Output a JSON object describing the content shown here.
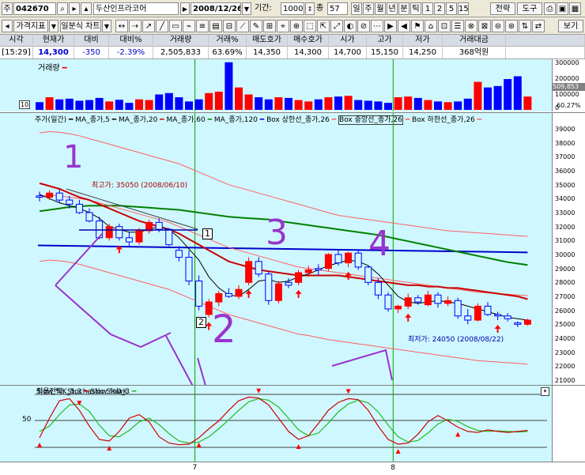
{
  "toolbar1": {
    "market_label": "주",
    "code": "042670",
    "name": "두산인프라코어",
    "date": "2008/12/26",
    "period_label": "기간:",
    "period_value": "1000",
    "count_label": "종",
    "count_value": "57",
    "interval_tabs": [
      "일",
      "주",
      "월",
      "년",
      "분",
      "틱",
      "1",
      "2",
      "5",
      "15"
    ],
    "strategy_button": "전략",
    "tools_button": "도구"
  },
  "toolbar2": {
    "price_indicator_label": "가격지표",
    "chart_type_label": "일분식 차트",
    "view_button": "보기"
  },
  "quote": {
    "headers": [
      "시각",
      "현재가",
      "대비",
      "대비%",
      "거래량",
      "거래%",
      "매도호가",
      "매수호가",
      "시가",
      "고가",
      "저가",
      "거래대금"
    ],
    "values": [
      "[15:29]",
      "14,300",
      "-350",
      "-2.39%",
      "2,505,833",
      "63.69%",
      "14,350",
      "14,300",
      "14,700",
      "15,150",
      "14,250",
      "368억원"
    ]
  },
  "volume_panel": {
    "title": "거래량",
    "scale_labels": [
      "300000",
      "200000",
      "100000",
      "0"
    ],
    "side_labels": [
      "509,853",
      "60.27%"
    ],
    "left_mark": "10"
  },
  "price_panel": {
    "legend": [
      "주가(일간)",
      "MA_종가,5",
      "MA_종가,20",
      "MA_종가,60",
      "MA_종가,120",
      "Box 상한선_종가,26",
      "Box 중앙선_종가,26",
      "Box 하한선_종가,26"
    ],
    "high_annotation": "최고가: 35050 (2008/06/10)",
    "low_annotation": "최저가: 24050 (2008/08/22)",
    "hand_marks": [
      "1",
      "2",
      "3",
      "4",
      "2"
    ],
    "box_marks": [
      "1",
      "2"
    ],
    "scale_labels": [
      "39000",
      "38000",
      "37000",
      "36000",
      "35000",
      "34000",
      "33000",
      "32000",
      "31000",
      "30000",
      "29000",
      "28000",
      "27000",
      "26000",
      "25000",
      "24000",
      "23000",
      "22000",
      "21000"
    ]
  },
  "stoch_panel": {
    "title": "적용전략: Stochastic SlowK",
    "legend": [
      "Slow %K_5,3",
      "Slow %D_3"
    ],
    "scale_labels": [
      "50"
    ]
  },
  "x_axis": {
    "labels": [
      "7",
      "8"
    ]
  },
  "colors": {
    "panel_bg": "#cff7ff",
    "up": "#ff0000",
    "down": "#0000ff",
    "ma5": "#000000",
    "ma20": "#cc0000",
    "ma60": "#008000",
    "ma120": "#0000cc",
    "box": "#ff6060",
    "hand": "#9933cc",
    "divider": "#00aa00"
  },
  "chart_data": {
    "type": "line",
    "title": "",
    "ylim": [
      21000,
      39500
    ],
    "ma120_y": 30650,
    "high": 35050,
    "low": 24050,
    "candles": [
      [
        34200,
        34500,
        33800,
        34100
      ],
      [
        34100,
        34600,
        33900,
        34400
      ],
      [
        34400,
        34700,
        33700,
        33900
      ],
      [
        33900,
        34200,
        33300,
        33600
      ],
      [
        33600,
        33900,
        32900,
        33000
      ],
      [
        33000,
        33300,
        32300,
        32400
      ],
      [
        32400,
        32700,
        31100,
        31200
      ],
      [
        31200,
        32200,
        31000,
        32000
      ],
      [
        32000,
        32200,
        31000,
        31200
      ],
      [
        31200,
        31600,
        30500,
        30900
      ],
      [
        30900,
        31900,
        30700,
        31700
      ],
      [
        31700,
        32500,
        31500,
        32300
      ],
      [
        32300,
        32600,
        31600,
        31800
      ],
      [
        31800,
        31900,
        30600,
        30700
      ],
      [
        30300,
        30600,
        29500,
        29800
      ],
      [
        29800,
        30300,
        27800,
        28100
      ],
      [
        28100,
        28500,
        26000,
        26300
      ],
      [
        25700,
        26800,
        25500,
        26600
      ],
      [
        26600,
        27400,
        26300,
        27200
      ],
      [
        27200,
        27600,
        26900,
        27000
      ],
      [
        27000,
        27800,
        26800,
        27500
      ],
      [
        28000,
        29800,
        27800,
        29500
      ],
      [
        29500,
        29800,
        28400,
        28600
      ],
      [
        28600,
        28800,
        26400,
        26700
      ],
      [
        26700,
        28100,
        26500,
        27900
      ],
      [
        28000,
        28300,
        27600,
        27800
      ],
      [
        28000,
        28900,
        27800,
        28700
      ],
      [
        28700,
        29200,
        28400,
        28900
      ],
      [
        29000,
        29300,
        28500,
        28900
      ],
      [
        29000,
        30100,
        28800,
        30000
      ],
      [
        30000,
        30300,
        29200,
        29400
      ],
      [
        29400,
        30200,
        29100,
        30100
      ],
      [
        30100,
        30300,
        28900,
        29100
      ],
      [
        29100,
        29200,
        27800,
        28000
      ],
      [
        28000,
        28300,
        26800,
        27100
      ],
      [
        27100,
        27300,
        25900,
        26100
      ],
      [
        26100,
        26400,
        25800,
        26300
      ],
      [
        26300,
        27200,
        26100,
        26900
      ],
      [
        26900,
        27100,
        26400,
        26600
      ],
      [
        26400,
        27400,
        26300,
        27100
      ],
      [
        27100,
        27300,
        26200,
        26500
      ],
      [
        26500,
        27000,
        26300,
        26700
      ],
      [
        26700,
        26900,
        25400,
        25600
      ],
      [
        25600,
        26100,
        25000,
        25300
      ],
      [
        25300,
        26500,
        25200,
        26300
      ],
      [
        26300,
        26600,
        25600,
        25700
      ],
      [
        25700,
        25900,
        25300,
        25600
      ],
      [
        25600,
        25800,
        25200,
        25400
      ],
      [
        25100,
        25200,
        24800,
        25000
      ],
      [
        25000,
        25400,
        24900,
        25300
      ]
    ],
    "volume": [
      55000,
      90000,
      75000,
      80000,
      65000,
      70000,
      85000,
      60000,
      72000,
      50000,
      75000,
      70000,
      110000,
      120000,
      90000,
      60000,
      75000,
      120000,
      130000,
      340000,
      160000,
      110000,
      90000,
      75000,
      90000,
      85000,
      70000,
      60000,
      75000,
      90000,
      95000,
      100000,
      70000,
      65000,
      60000,
      50000,
      90000,
      95000,
      85000,
      70000,
      60000,
      55000,
      60000,
      80000,
      200000,
      160000,
      170000,
      220000,
      240000,
      95000,
      100000,
      90000
    ],
    "ma5": [
      34300,
      34000,
      33700,
      33500,
      33300,
      33000,
      32600,
      32000,
      31800,
      31600,
      31600,
      31800,
      32000,
      31800,
      31200,
      30400,
      29600,
      28400,
      27600,
      27100,
      27000,
      27500,
      28100,
      28200,
      28000,
      28100,
      28400,
      28600,
      28900,
      29200,
      29400,
      29600,
      29500,
      29200,
      28600,
      27800,
      27000,
      26600,
      26500,
      26600,
      26700,
      26600,
      26500,
      26300,
      26100,
      25900,
      25700,
      25500,
      25400,
      25300
    ],
    "ma20": [
      35100,
      34900,
      34700,
      34400,
      34100,
      33900,
      33600,
      33300,
      33000,
      32700,
      32400,
      32200,
      32000,
      31800,
      31500,
      31100,
      30700,
      30300,
      29900,
      29500,
      29300,
      29100,
      28900,
      28800,
      28700,
      28600,
      28500,
      28500,
      28500,
      28500,
      28500,
      28400,
      28300,
      28200,
      28100,
      28000,
      27900,
      27800,
      27800,
      27700,
      27700,
      27600,
      27600,
      27500,
      27400,
      27300,
      27200,
      27100,
      27000,
      26800
    ],
    "ma60": [
      33100,
      33200,
      33300,
      33400,
      33450,
      33500,
      33500,
      33500,
      33500,
      33450,
      33400,
      33350,
      33300,
      33250,
      33200,
      33100,
      33000,
      32900,
      32800,
      32700,
      32650,
      32600,
      32550,
      32500,
      32400,
      32300,
      32200,
      32100,
      32000,
      31900,
      31800,
      31700,
      31600,
      31500,
      31400,
      31250,
      31100,
      30950,
      30800,
      30650,
      30500,
      30350,
      30200,
      30050,
      29900,
      29750,
      29600,
      29450,
      29350,
      29250
    ],
    "box_upper": [
      38700,
      38800,
      38750,
      38650,
      38500,
      38300,
      38100,
      37900,
      37700,
      37500,
      37300,
      37100,
      36900,
      36700,
      36500,
      36200,
      35900,
      35600,
      35300,
      35000,
      34800,
      34600,
      34400,
      34200,
      34000,
      33800,
      33600,
      33400,
      33200,
      33000,
      32800,
      32700,
      32600,
      32500,
      32400,
      32300,
      32200,
      32100,
      32000,
      31900,
      31800,
      31700,
      31650,
      31600,
      31550,
      31500,
      31450,
      31400,
      31350,
      31300
    ],
    "box_middle": [
      34200,
      34250,
      34200,
      34100,
      34000,
      33900,
      33700,
      33500,
      33300,
      33100,
      32900,
      32700,
      32500,
      32300,
      32000,
      31700,
      31400,
      31100,
      30800,
      30500,
      30300,
      30100,
      29900,
      29700,
      29500,
      29300,
      29100,
      29000,
      28900,
      28800,
      28700,
      28600,
      28500,
      28400,
      28300,
      28200,
      28100,
      28000,
      27900,
      27800,
      27700,
      27600,
      27500,
      27400,
      27300,
      27250,
      27200,
      27150,
      27100,
      27050
    ],
    "box_lower": [
      29500,
      29600,
      29550,
      29450,
      29300,
      29100,
      28900,
      28700,
      28500,
      28300,
      28100,
      27900,
      27700,
      27500,
      27200,
      26900,
      26600,
      26300,
      26000,
      25700,
      25500,
      25300,
      25100,
      24900,
      24700,
      24500,
      24300,
      24200,
      24050,
      23900,
      23800,
      23700,
      23600,
      23500,
      23400,
      23300,
      23200,
      23100,
      23000,
      22900,
      22800,
      22700,
      22600,
      22500,
      22400,
      22350,
      22300,
      22250,
      22200,
      22150
    ],
    "slow_k": [
      18,
      55,
      88,
      92,
      70,
      40,
      15,
      12,
      30,
      55,
      62,
      48,
      20,
      8,
      5,
      6,
      18,
      35,
      50,
      70,
      88,
      95,
      93,
      80,
      55,
      30,
      15,
      22,
      45,
      70,
      85,
      92,
      90,
      70,
      40,
      15,
      6,
      8,
      25,
      48,
      60,
      50,
      38,
      30,
      28,
      33,
      30,
      28,
      30,
      32
    ],
    "slow_d": [
      30,
      40,
      62,
      80,
      82,
      68,
      42,
      22,
      20,
      32,
      48,
      55,
      43,
      26,
      12,
      8,
      10,
      20,
      35,
      52,
      70,
      86,
      92,
      89,
      76,
      55,
      33,
      22,
      27,
      46,
      67,
      82,
      89,
      84,
      67,
      42,
      20,
      10,
      13,
      27,
      44,
      53,
      49,
      39,
      32,
      30,
      31,
      30,
      29,
      30
    ]
  }
}
